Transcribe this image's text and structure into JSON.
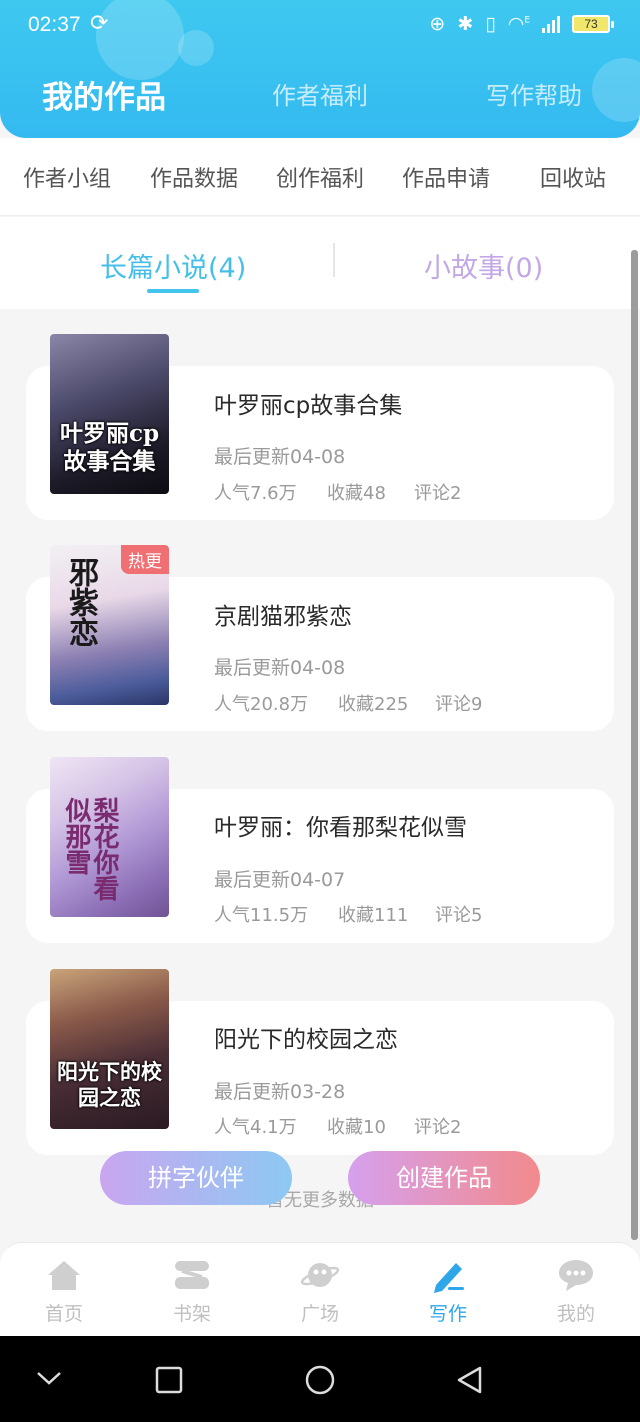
{
  "status_bar": {
    "time": "02:37",
    "sync_icon": "sync-icon",
    "battery": "73",
    "wifi_badge": "E"
  },
  "header": {
    "tabs": [
      {
        "label": "我的作品",
        "active": true
      },
      {
        "label": "作者福利",
        "active": false
      },
      {
        "label": "写作帮助",
        "active": false
      }
    ]
  },
  "shortcuts": [
    "作者小组",
    "作品数据",
    "创作福利",
    "作品申请",
    "回收站"
  ],
  "segments": [
    {
      "label": "长篇小说(4)",
      "active": true
    },
    {
      "label": "小故事(0)",
      "active": false
    }
  ],
  "books": [
    {
      "title": "叶罗丽cp故事合集",
      "updated": "最后更新04-08",
      "popularity": "人气7.6万",
      "favorites": "收藏48",
      "comments": "评论2",
      "cover_text": "叶罗丽cp故事合集",
      "hot": false
    },
    {
      "title": "京剧猫邪紫恋",
      "updated": "最后更新04-08",
      "popularity": "人气20.8万",
      "favorites": "收藏225",
      "comments": "评论9",
      "cover_text": "邪紫恋",
      "hot": true,
      "hot_label": "热更"
    },
    {
      "title": "叶罗丽：你看那梨花似雪",
      "updated": "最后更新04-07",
      "popularity": "人气11.5万",
      "favorites": "收藏111",
      "comments": "评论5",
      "cover_text": "梨花你看似那雪",
      "hot": false
    },
    {
      "title": "阳光下的校园之恋",
      "updated": "最后更新03-28",
      "popularity": "人气4.1万",
      "favorites": "收藏10",
      "comments": "评论2",
      "cover_text": "阳光下的校园之恋",
      "hot": false
    }
  ],
  "footer_text": "暂无更多数据",
  "fab": {
    "partner": "拼字伙伴",
    "create": "创建作品"
  },
  "bottom_nav": [
    {
      "label": "首页",
      "icon": "home-icon",
      "active": false
    },
    {
      "label": "书架",
      "icon": "bookshelf-icon",
      "active": false
    },
    {
      "label": "广场",
      "icon": "planet-icon",
      "active": false
    },
    {
      "label": "写作",
      "icon": "pen-icon",
      "active": true
    },
    {
      "label": "我的",
      "icon": "chat-bubble-icon",
      "active": false
    }
  ],
  "system_nav": [
    "collapse-icon",
    "recents-icon",
    "home-circle-icon",
    "back-icon"
  ]
}
